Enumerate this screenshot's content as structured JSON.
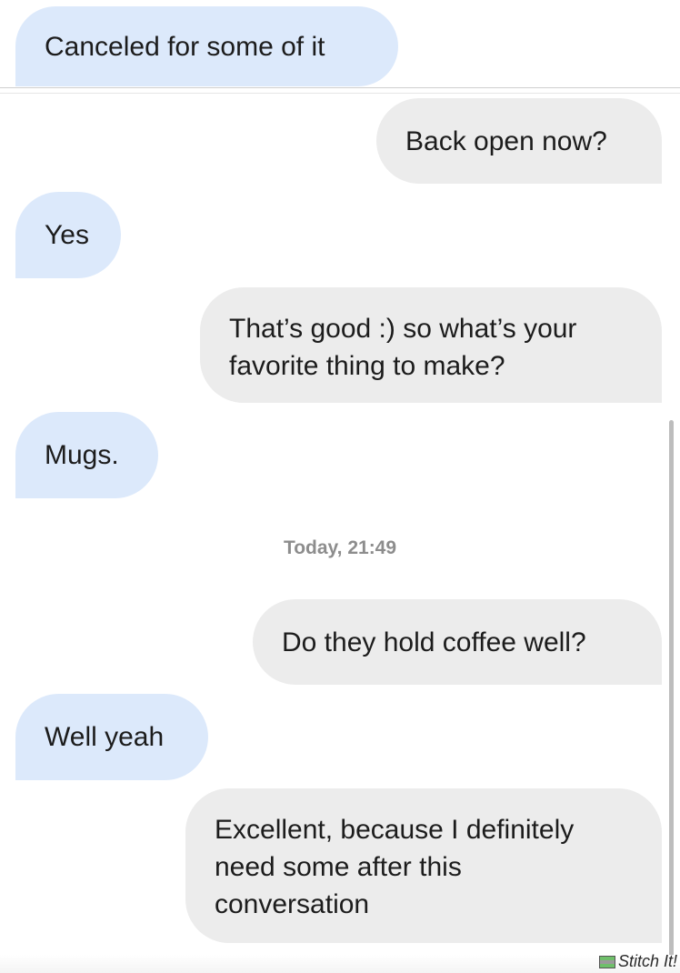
{
  "messages": [
    {
      "direction": "incoming",
      "text": "Canceled for some of it"
    },
    {
      "direction": "outgoing",
      "text": "Back open now?"
    },
    {
      "direction": "incoming",
      "text": "Yes"
    },
    {
      "direction": "outgoing",
      "lines": [
        "That’s good :) so what’s your",
        "favorite thing to make?"
      ]
    },
    {
      "direction": "incoming",
      "text": "Mugs."
    },
    {
      "direction": "outgoing",
      "text": "Do they hold coffee well?"
    },
    {
      "direction": "incoming",
      "text": "Well yeah"
    },
    {
      "direction": "outgoing",
      "lines": [
        "Excellent, because I definitely",
        "need some after this",
        "conversation"
      ]
    }
  ],
  "timestamp": "Today, 21:49",
  "watermark": {
    "label": "Stitch It!",
    "icon": "stitch-logo-icon"
  },
  "colors": {
    "incoming_bubble": "#dce9fb",
    "outgoing_bubble": "#ececec",
    "text": "#1c1c1c",
    "timestamp": "#8d8d8d"
  }
}
